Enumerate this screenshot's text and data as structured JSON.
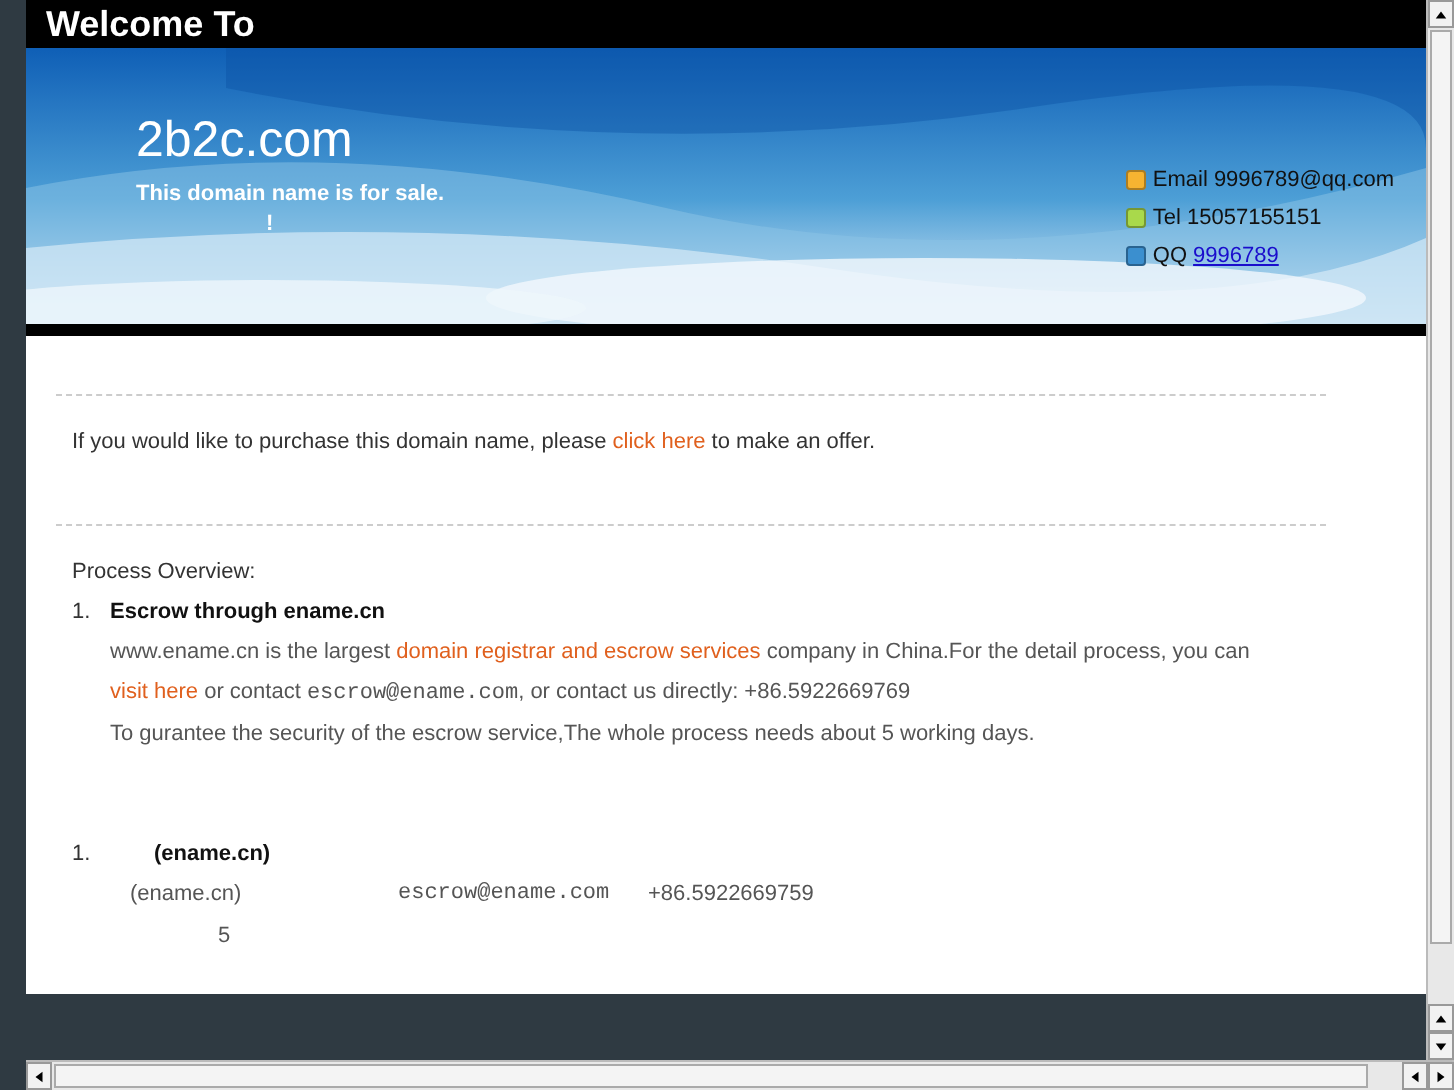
{
  "header": {
    "title": "Welcome To"
  },
  "banner": {
    "kind": "picture",
    "domain": "2b2c.com",
    "tagline": "This domain name is for sale.",
    "mark": "!"
  },
  "contacts": [
    {
      "label": "Email",
      "value": "9996789@qq.com",
      "link": false,
      "color": "#f7b431"
    },
    {
      "label": "Tel",
      "value": "15057155151",
      "link": false,
      "color": "#a9d94b"
    },
    {
      "label": "QQ",
      "value": "9996789",
      "link": true,
      "color": "#3b8fcf"
    }
  ],
  "offer": [
    {
      "kind": "text",
      "text": "If you would like to purchase this domain name, please "
    },
    {
      "kind": "link",
      "text": "click here"
    },
    {
      "kind": "text",
      "text": " to make an offer."
    }
  ],
  "process": {
    "title": "Process Overview:",
    "steps": [
      {
        "number": "1.",
        "title": "Escrow through ename.cn",
        "paragraphs": [
          [
            {
              "kind": "text",
              "text": "www.ename.cn is the largest "
            },
            {
              "kind": "link",
              "text": "domain registrar and escrow services"
            },
            {
              "kind": "text",
              "text": " company in China.For the detail process, you can "
            },
            {
              "kind": "link",
              "text": "visit here"
            },
            {
              "kind": "text",
              "text": " or contact "
            },
            {
              "kind": "code",
              "text": "escrow@ename.com"
            },
            {
              "kind": "text",
              "text": ", or contact us directly: +86.5922669769"
            }
          ],
          [
            {
              "kind": "text",
              "text": "To gurantee the security of the escrow service,The whole process needs about 5 working days."
            }
          ]
        ]
      }
    ]
  },
  "second": {
    "number": "1.",
    "title": "(ename.cn)",
    "cells": [
      {
        "kind": "text",
        "text": "(ename.cn)"
      },
      {
        "kind": "code",
        "text": "escrow@ename.com"
      },
      {
        "kind": "text",
        "text": "+86.5922669759"
      }
    ],
    "note": "5"
  }
}
